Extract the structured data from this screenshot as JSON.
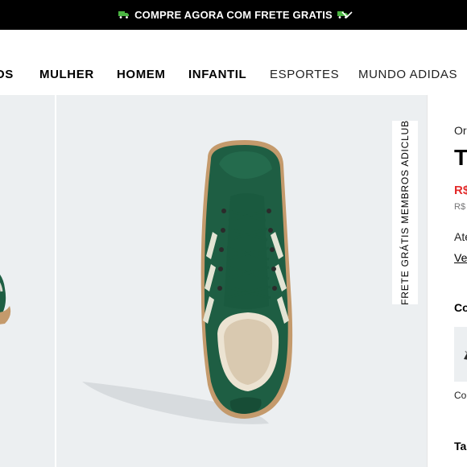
{
  "promo": {
    "text": "COMPRE AGORA COM FRETE GRATIS",
    "truck_icon": "truck-icon",
    "accent": "#4bb543"
  },
  "nav": {
    "items": [
      {
        "label": "OS",
        "weight": "bold"
      },
      {
        "label": "MULHER",
        "weight": "bold"
      },
      {
        "label": "HOMEM",
        "weight": "bold"
      },
      {
        "label": "INFANTIL",
        "weight": "bold"
      },
      {
        "label": "ESPORTES",
        "weight": "light"
      },
      {
        "label": "MUNDO ADIDAS",
        "weight": "light"
      }
    ]
  },
  "gallery": {
    "badge": "FRETE GRÁTIS MEMBROS ADICLUB",
    "shoe_color": "#1e5e43"
  },
  "product": {
    "category": "Or",
    "title": "T",
    "price": "R$",
    "old_price": "R$",
    "installments": "Ate",
    "link": "Ve",
    "colors_heading": "Co",
    "swatch_label": "Co",
    "size_heading": "Ta",
    "price_color": "#e32b2b"
  }
}
